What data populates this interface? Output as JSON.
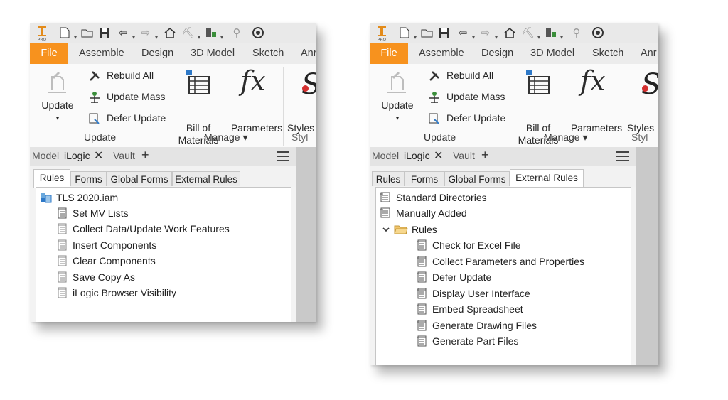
{
  "panels": [
    {
      "qat_icons": [
        "inventor-logo",
        "new-file-icon",
        "open-folder-icon",
        "save-icon",
        "undo-icon",
        "redo-icon",
        "home-icon",
        "project-icon",
        "appearance-icon",
        "material-icon",
        "settings-icon"
      ],
      "ribbon_tabs": {
        "file": "File",
        "assemble": "Assemble",
        "design": "Design",
        "model": "3D Model",
        "sketch": "Sketch",
        "annotate": "Anr"
      },
      "ribbon": {
        "update_label": "Update",
        "rebuild_all": "Rebuild All",
        "update_mass": "Update Mass",
        "defer_update": "Defer Update",
        "group_update": "Update",
        "bom_line1": "Bill of",
        "bom_line2": "Materials",
        "parameters": "Parameters",
        "group_manage": "Manage",
        "styles": "Styles",
        "group_styles": "Styl"
      },
      "browser_tabs": {
        "model": "Model",
        "ilogic": "iLogic",
        "vault": "Vault"
      },
      "ilogic_tabs": {
        "rules": "Rules",
        "forms": "Forms",
        "global_forms": "Global Forms",
        "external_rules": "External Rules",
        "active": "rules"
      },
      "tree": [
        {
          "label": "TLS 2020.iam",
          "icon": "assembly-icon",
          "level": 0
        },
        {
          "label": "Set MV Lists",
          "icon": "rule-icon",
          "level": 1
        },
        {
          "label": "Collect Data/Update Work Features",
          "icon": "rule-icon",
          "level": 1
        },
        {
          "label": "Insert Components",
          "icon": "rule-icon",
          "level": 1
        },
        {
          "label": "Clear Components",
          "icon": "rule-icon",
          "level": 1
        },
        {
          "label": "Save Copy As",
          "icon": "rule-icon",
          "level": 1
        },
        {
          "label": "iLogic Browser Visibility",
          "icon": "rule-icon",
          "level": 1
        }
      ]
    },
    {
      "qat_icons": [
        "inventor-logo",
        "new-file-icon",
        "open-folder-icon",
        "save-icon",
        "undo-icon",
        "redo-icon",
        "home-icon",
        "project-icon",
        "appearance-icon",
        "material-icon",
        "settings-icon"
      ],
      "ribbon_tabs": {
        "file": "File",
        "assemble": "Assemble",
        "design": "Design",
        "model": "3D Model",
        "sketch": "Sketch",
        "annotate": "Anr"
      },
      "ribbon": {
        "update_label": "Update",
        "rebuild_all": "Rebuild All",
        "update_mass": "Update Mass",
        "defer_update": "Defer Update",
        "group_update": "Update",
        "bom_line1": "Bill of",
        "bom_line2": "Materials",
        "parameters": "Parameters",
        "group_manage": "Manage",
        "styles": "Styles",
        "group_styles": "Styl"
      },
      "browser_tabs": {
        "model": "Model",
        "ilogic": "iLogic",
        "vault": "Vault"
      },
      "ilogic_tabs": {
        "rules": "Rules",
        "forms": "Forms",
        "global_forms": "Global Forms",
        "external_rules": "External Rules",
        "active": "external_rules"
      },
      "tree": [
        {
          "label": "Standard Directories",
          "icon": "directory-icon",
          "level": 0
        },
        {
          "label": "Manually Added",
          "icon": "directory-icon",
          "level": 0
        },
        {
          "label": "Rules",
          "icon": "folder-icon",
          "level": 0,
          "expanded": true
        },
        {
          "label": "Check for Excel File",
          "icon": "rule-icon",
          "level": 2
        },
        {
          "label": "Collect Parameters and Properties",
          "icon": "rule-icon",
          "level": 2
        },
        {
          "label": "Defer Update",
          "icon": "rule-icon",
          "level": 2
        },
        {
          "label": "Display User Interface",
          "icon": "rule-icon",
          "level": 2
        },
        {
          "label": "Embed Spreadsheet",
          "icon": "rule-icon",
          "level": 2
        },
        {
          "label": "Generate Drawing Files",
          "icon": "rule-icon",
          "level": 2
        },
        {
          "label": "Generate Part Files",
          "icon": "rule-icon",
          "level": 2
        }
      ]
    }
  ]
}
